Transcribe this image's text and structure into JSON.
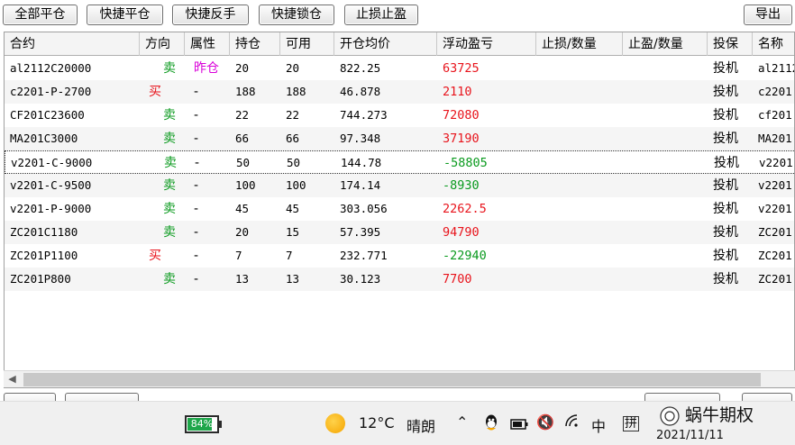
{
  "toolbar": {
    "close_all": "全部平仓",
    "quick_close": "快捷平仓",
    "quick_reverse": "快捷反手",
    "quick_lock": "快捷锁仓",
    "stop_loss_profit": "止损止盈",
    "export": "导出"
  },
  "columns": [
    "合约",
    "方向",
    "属性",
    "持仓",
    "可用",
    "开仓均价",
    "浮动盈亏",
    "止损/数量",
    "止盈/数量",
    "投保",
    "名称"
  ],
  "rows": [
    {
      "contract": "al2112C20000",
      "direction": "卖",
      "attr": "昨仓",
      "hold": "20",
      "avail": "20",
      "avg": "822.25",
      "pnl": "63725",
      "hedge": "投机",
      "name": "al2112"
    },
    {
      "contract": "c2201-P-2700",
      "direction": "买",
      "attr": "-",
      "hold": "188",
      "avail": "188",
      "avg": "46.878",
      "pnl": "2110",
      "hedge": "投机",
      "name": "c2201"
    },
    {
      "contract": "CF201C23600",
      "direction": "卖",
      "attr": "-",
      "hold": "22",
      "avail": "22",
      "avg": "744.273",
      "pnl": "72080",
      "hedge": "投机",
      "name": "cf201"
    },
    {
      "contract": "MA201C3000",
      "direction": "卖",
      "attr": "-",
      "hold": "66",
      "avail": "66",
      "avg": "97.348",
      "pnl": "37190",
      "hedge": "投机",
      "name": "MA201"
    },
    {
      "contract": "v2201-C-9000",
      "direction": "卖",
      "attr": "-",
      "hold": "50",
      "avail": "50",
      "avg": "144.78",
      "pnl": "-58805",
      "hedge": "投机",
      "name": "v2201"
    },
    {
      "contract": "v2201-C-9500",
      "direction": "卖",
      "attr": "-",
      "hold": "100",
      "avail": "100",
      "avg": "174.14",
      "pnl": "-8930",
      "hedge": "投机",
      "name": "v2201"
    },
    {
      "contract": "v2201-P-9000",
      "direction": "卖",
      "attr": "-",
      "hold": "45",
      "avail": "45",
      "avg": "303.056",
      "pnl": "2262.5",
      "hedge": "投机",
      "name": "v2201"
    },
    {
      "contract": "ZC201C1180",
      "direction": "卖",
      "attr": "-",
      "hold": "20",
      "avail": "15",
      "avg": "57.395",
      "pnl": "94790",
      "hedge": "投机",
      "name": "ZC201"
    },
    {
      "contract": "ZC201P1100",
      "direction": "买",
      "attr": "-",
      "hold": "7",
      "avail": "7",
      "avg": "232.771",
      "pnl": "-22940",
      "hedge": "投机",
      "name": "ZC201"
    },
    {
      "contract": "ZC201P800",
      "direction": "卖",
      "attr": "-",
      "hold": "13",
      "avail": "13",
      "avg": "30.123",
      "pnl": "7700",
      "hedge": "投机",
      "name": "ZC201"
    }
  ],
  "taskbar": {
    "battery": "84%",
    "battery_level": 0.84,
    "temperature": "12°C",
    "weather": "晴朗",
    "ime": "中",
    "ime2": "拼",
    "date": "2021/11/11",
    "watermark": "蜗牛期权"
  },
  "colors": {
    "buy": "#e8141c",
    "sell": "#0a9a1e",
    "profit": "#e8141c",
    "loss": "#0a9a1e",
    "yesterday": "#d900d9"
  }
}
